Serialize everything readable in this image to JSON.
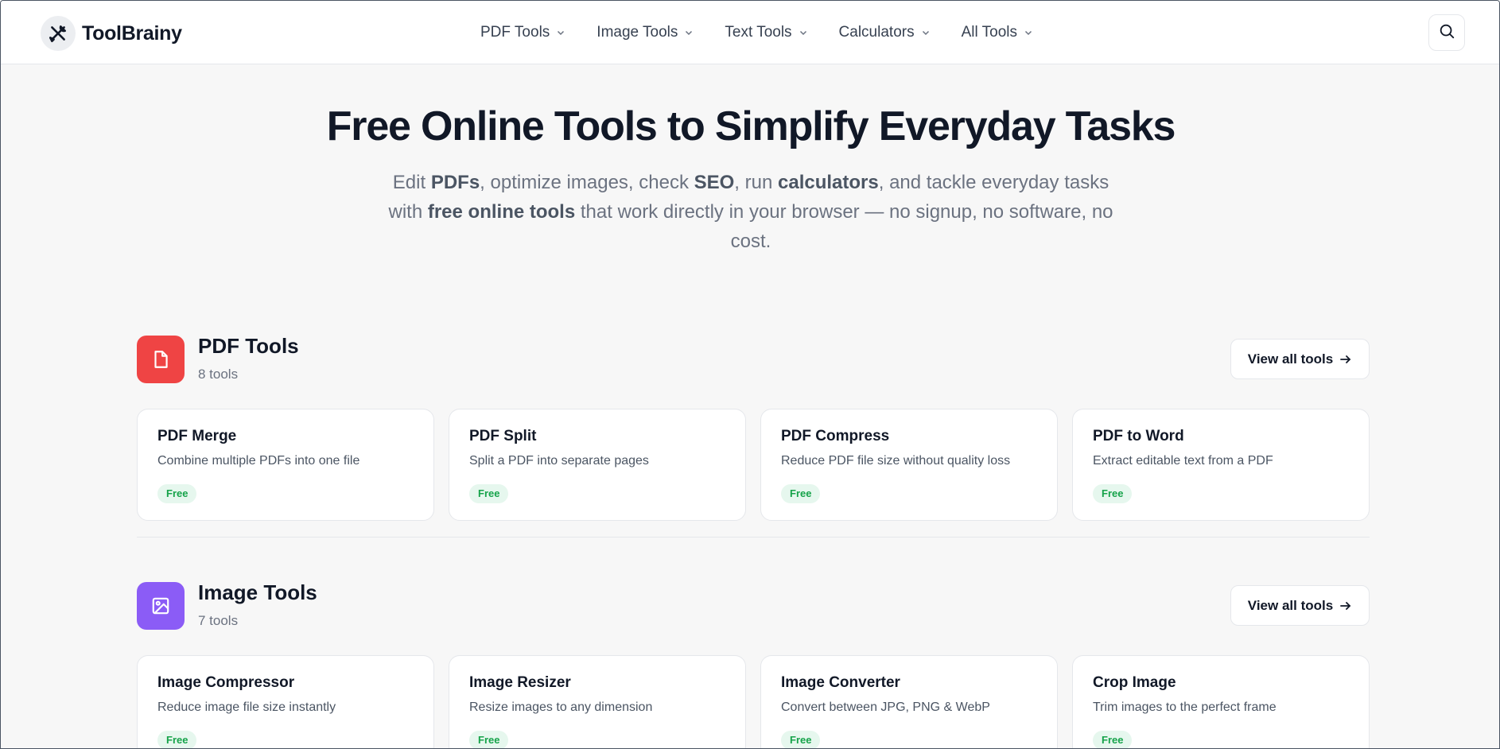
{
  "brand": {
    "name": "ToolBrainy",
    "icon": "tools-icon"
  },
  "nav": [
    {
      "label": "PDF Tools"
    },
    {
      "label": "Image Tools"
    },
    {
      "label": "Text Tools"
    },
    {
      "label": "Calculators"
    },
    {
      "label": "All Tools"
    }
  ],
  "search": {
    "icon": "search-icon"
  },
  "hero": {
    "title": "Free Online Tools to Simplify Everyday Tasks",
    "sub": {
      "t1": "Edit ",
      "b1": "PDFs",
      "t2": ", optimize images, check ",
      "b2": "SEO",
      "t3": ", run ",
      "b3": "calculators",
      "t4": ", and tackle everyday tasks with ",
      "b4": "free online tools",
      "t5": " that work directly in your browser — no signup, no software, no cost."
    }
  },
  "sections": [
    {
      "title": "PDF Tools",
      "count": "8 tools",
      "icon": "document-icon",
      "color": "#ef4444",
      "view_all": "View all tools",
      "tools": [
        {
          "name": "PDF Merge",
          "desc": "Combine multiple PDFs into one file",
          "badge": "Free"
        },
        {
          "name": "PDF Split",
          "desc": "Split a PDF into separate pages",
          "badge": "Free"
        },
        {
          "name": "PDF Compress",
          "desc": "Reduce PDF file size without quality loss",
          "badge": "Free"
        },
        {
          "name": "PDF to Word",
          "desc": "Extract editable text from a PDF",
          "badge": "Free"
        }
      ]
    },
    {
      "title": "Image Tools",
      "count": "7 tools",
      "icon": "image-icon",
      "color": "#8b5cf6",
      "view_all": "View all tools",
      "tools": [
        {
          "name": "Image Compressor",
          "desc": "Reduce image file size instantly",
          "badge": "Free"
        },
        {
          "name": "Image Resizer",
          "desc": "Resize images to any dimension",
          "badge": "Free"
        },
        {
          "name": "Image Converter",
          "desc": "Convert between JPG, PNG & WebP",
          "badge": "Free"
        },
        {
          "name": "Crop Image",
          "desc": "Trim images to the perfect frame",
          "badge": "Free"
        }
      ]
    }
  ]
}
